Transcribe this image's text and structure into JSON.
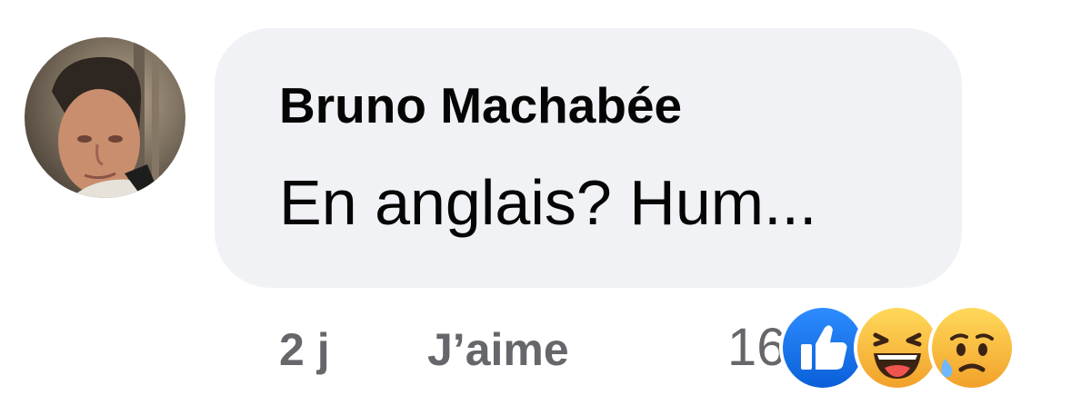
{
  "comment": {
    "author": "Bruno Machabée",
    "text": "En anglais? Hum...",
    "timestamp": "2 j",
    "like_label": "J’aime",
    "avatar_icon": "profile-photo"
  },
  "reactions": {
    "count": "16",
    "icons": [
      "like-reaction-icon",
      "haha-reaction-icon",
      "sad-reaction-icon"
    ],
    "colors": {
      "like": "#1877f2",
      "emoji": "#f7b125"
    }
  }
}
